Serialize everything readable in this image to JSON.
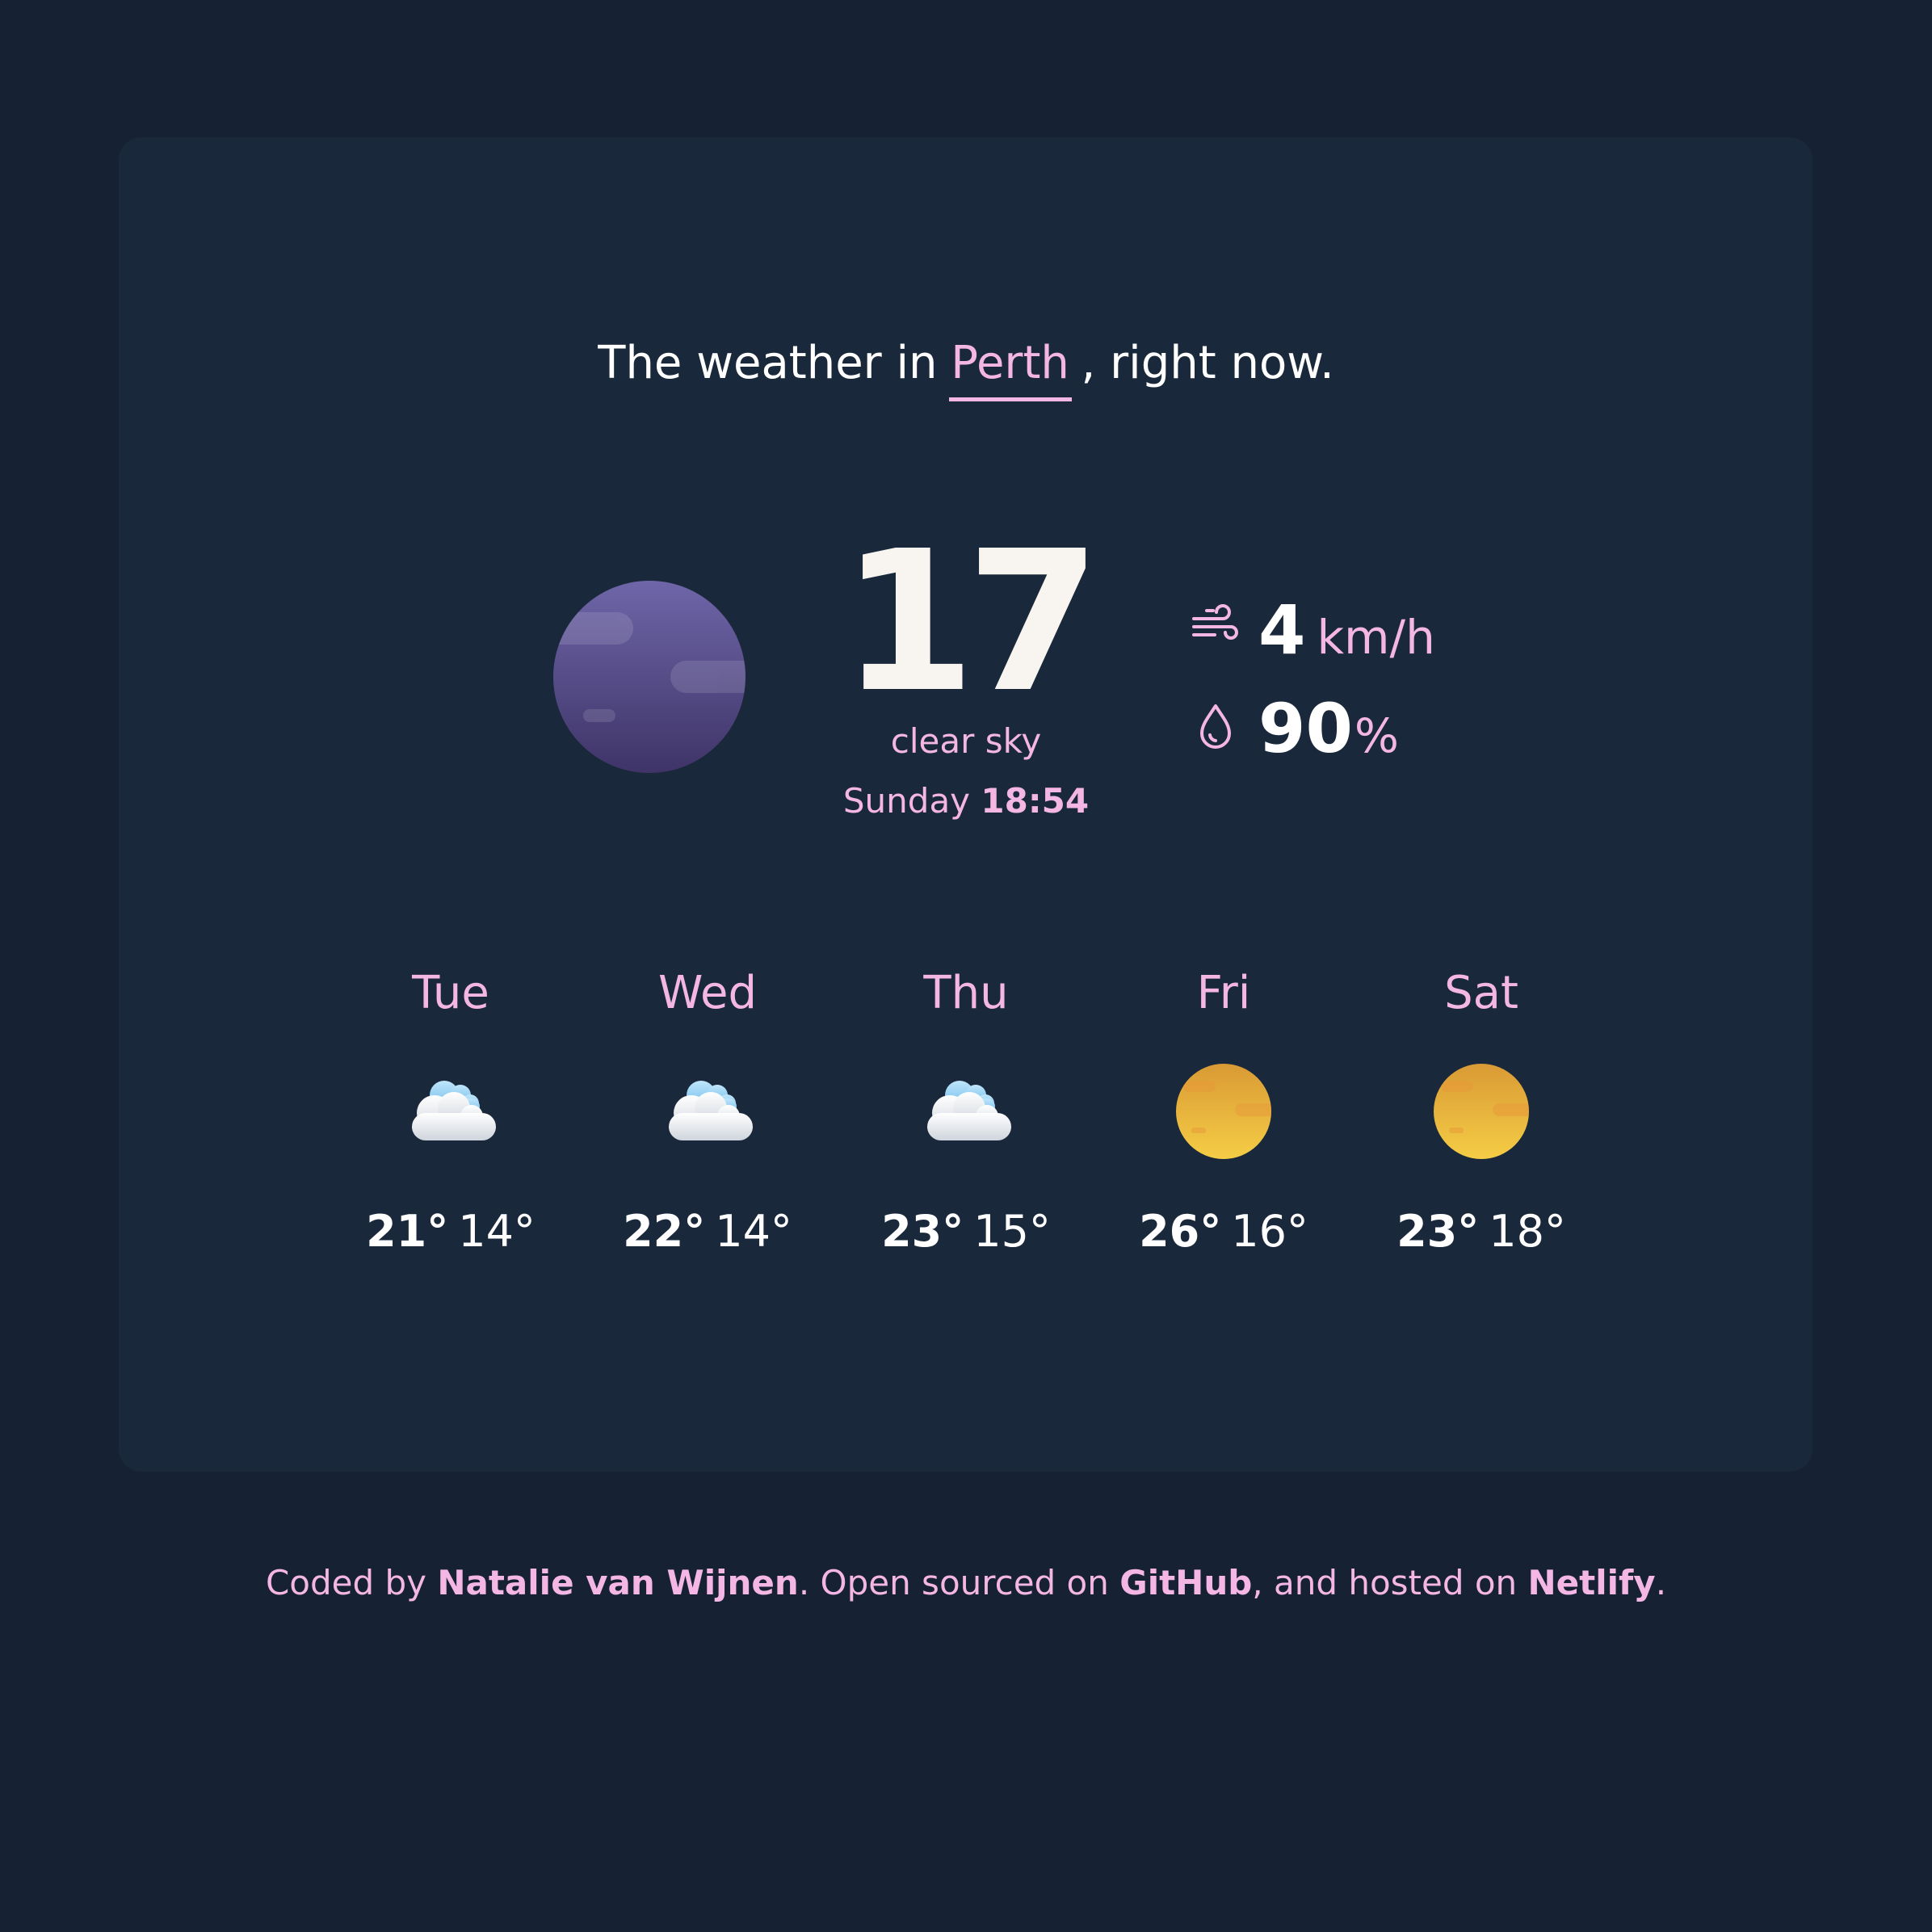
{
  "header": {
    "prefix": "The weather in",
    "city_value": "Perth",
    "suffix": ", right now."
  },
  "current": {
    "icon": "moon-night-icon",
    "temperature": "17",
    "description": "clear sky",
    "day": "Sunday",
    "time": "18:54",
    "wind": {
      "icon": "wind-icon",
      "value": "4",
      "unit": "km/h"
    },
    "humidity": {
      "icon": "droplet-icon",
      "value": "90",
      "unit": "%"
    }
  },
  "forecast": [
    {
      "day": "Tue",
      "icon": "cloud-icon",
      "high": "21°",
      "low": "14°"
    },
    {
      "day": "Wed",
      "icon": "cloud-icon",
      "high": "22°",
      "low": "14°"
    },
    {
      "day": "Thu",
      "icon": "cloud-icon",
      "high": "23°",
      "low": "15°"
    },
    {
      "day": "Fri",
      "icon": "sun-icon",
      "high": "26°",
      "low": "16°"
    },
    {
      "day": "Sat",
      "icon": "sun-icon",
      "high": "23°",
      "low": "18°"
    }
  ],
  "footer": {
    "text1": "Coded by ",
    "author": "Natalie van Wijnen",
    "text2": ". Open sourced on ",
    "github": "GitHub",
    "text3": ", and hosted on ",
    "netlify": "Netlify",
    "text4": "."
  },
  "colors": {
    "background": "#162233",
    "card": "#1a283b",
    "accent": "#f4b6e4",
    "text": "#ffffff",
    "moon": "#5e5294",
    "sun": "#f0b83d"
  }
}
